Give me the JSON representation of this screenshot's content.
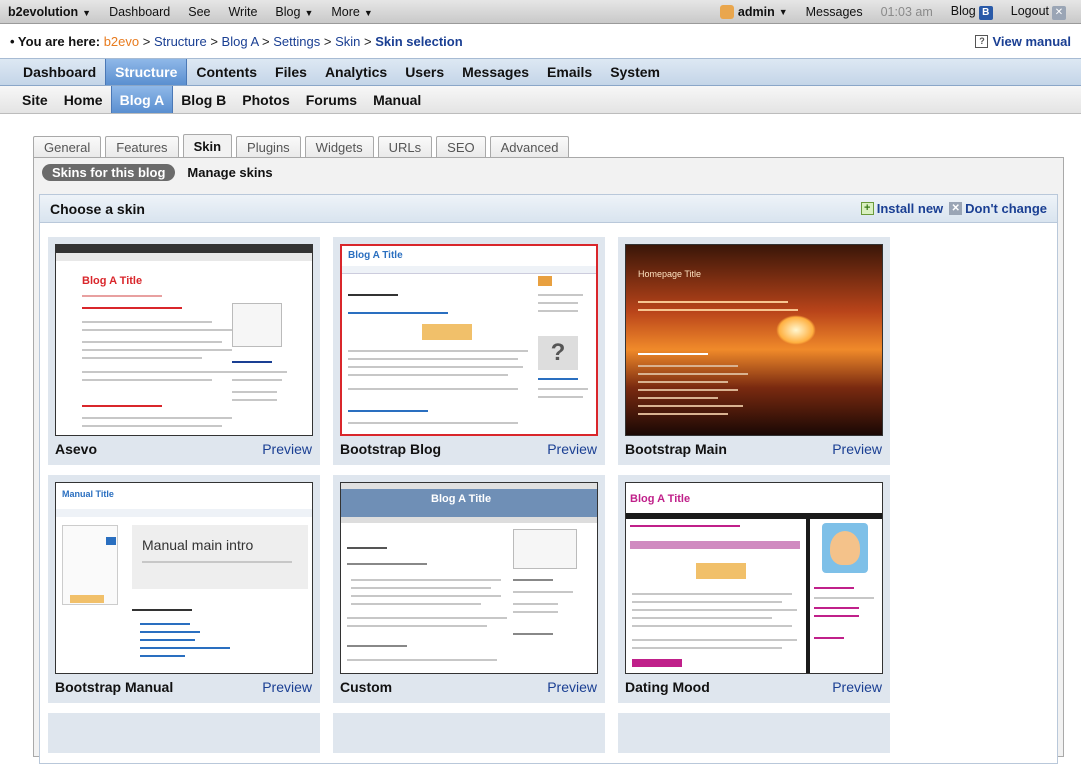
{
  "topbar": {
    "brand": "b2evolution",
    "items": [
      "Dashboard",
      "See",
      "Write",
      "Blog",
      "More"
    ],
    "user": "admin",
    "messages": "Messages",
    "time": "01:03 am",
    "blog": "Blog",
    "blog_icon": "B",
    "logout": "Logout"
  },
  "breadcrumb": {
    "prefix": "• You are here:",
    "items": [
      "b2evo",
      "Structure",
      "Blog A",
      "Settings",
      "Skin"
    ],
    "separator": ">",
    "current": "Skin selection",
    "manual": "View manual"
  },
  "mainmenu": [
    "Dashboard",
    "Structure",
    "Contents",
    "Files",
    "Analytics",
    "Users",
    "Messages",
    "Emails",
    "System"
  ],
  "blogmenu": [
    "Site",
    "Home",
    "Blog A",
    "Blog B",
    "Photos",
    "Forums",
    "Manual"
  ],
  "tabs": [
    "General",
    "Features",
    "Skin",
    "Plugins",
    "Widgets",
    "URLs",
    "SEO",
    "Advanced"
  ],
  "subtabs": {
    "active": "Skins for this blog",
    "other": "Manage skins"
  },
  "panel": {
    "title": "Choose a skin",
    "install": "Install new",
    "dont_change": "Don't change"
  },
  "skins": [
    {
      "name": "Asevo",
      "preview": "Preview",
      "thumb_title": "Blog A Title",
      "selected": false
    },
    {
      "name": "Bootstrap Blog",
      "preview": "Preview",
      "thumb_title": "Blog A Title",
      "selected": true
    },
    {
      "name": "Bootstrap Main",
      "preview": "Preview",
      "thumb_title": "Homepage Title",
      "selected": false
    },
    {
      "name": "Bootstrap Manual",
      "preview": "Preview",
      "thumb_title": "Manual main intro",
      "selected": false
    },
    {
      "name": "Custom",
      "preview": "Preview",
      "thumb_title": "Blog A Title",
      "selected": false
    },
    {
      "name": "Dating Mood",
      "preview": "Preview",
      "thumb_title": "Blog A Title",
      "selected": false
    }
  ],
  "colors": {
    "accent": "#5a8fd0",
    "link": "#1a3f93",
    "selected_border": "#d9262b"
  }
}
